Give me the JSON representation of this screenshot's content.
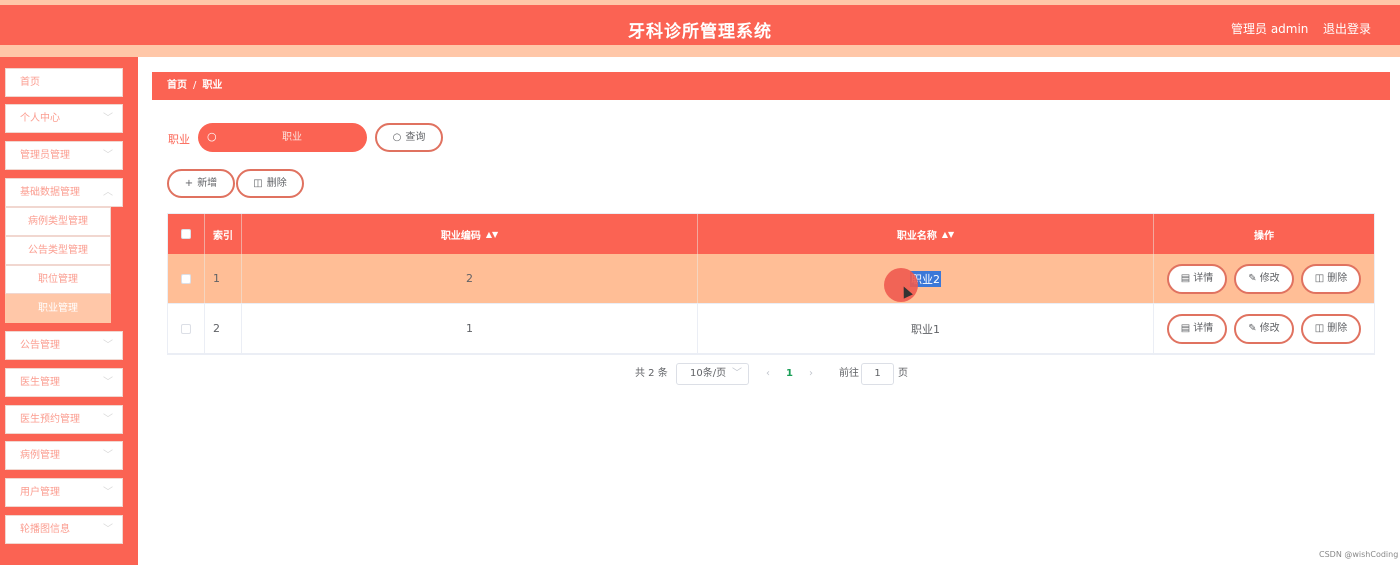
{
  "header": {
    "title": "牙科诊所管理系统",
    "admin_text": "管理员 admin",
    "logout": "退出登录"
  },
  "sidebar": {
    "items": [
      {
        "label": "首页",
        "has_chevron": false
      },
      {
        "label": "个人中心",
        "has_chevron": true
      },
      {
        "label": "管理员管理",
        "has_chevron": true
      },
      {
        "label": "基础数据管理",
        "has_chevron": true,
        "expanded": true
      },
      {
        "label": "公告管理",
        "has_chevron": true
      },
      {
        "label": "医生管理",
        "has_chevron": true
      },
      {
        "label": "医生预约管理",
        "has_chevron": true
      },
      {
        "label": "病例管理",
        "has_chevron": true
      },
      {
        "label": "用户管理",
        "has_chevron": true
      },
      {
        "label": "轮播图信息",
        "has_chevron": true
      }
    ],
    "sub_items": [
      {
        "label": "病例类型管理"
      },
      {
        "label": "公告类型管理"
      },
      {
        "label": "职位管理"
      },
      {
        "label": "职业管理",
        "active": true
      }
    ]
  },
  "breadcrumb": {
    "home": "首页",
    "separator": "/",
    "current": "职业"
  },
  "search": {
    "label": "职业",
    "placeholder": "职业",
    "value": "",
    "search_icon": "search-icon",
    "query_button": "查询"
  },
  "toolbar": {
    "add_button": "新增",
    "delete_button": "删除"
  },
  "table": {
    "columns": [
      "",
      "索引",
      "职业编码",
      "职业名称",
      "操作"
    ],
    "rows": [
      {
        "index": "1",
        "code": "2",
        "name": "职业2"
      },
      {
        "index": "2",
        "code": "1",
        "name": "职业1"
      }
    ],
    "row_actions": {
      "detail": "详情",
      "edit": "修改",
      "delete": "删除"
    }
  },
  "pagination": {
    "total": "共 2 条",
    "page_size": "10条/页",
    "current_page": "1",
    "goto_label": "前往",
    "goto_value": "1",
    "page_suffix": "页"
  },
  "watermark": "CSDN @wishCoding",
  "colors": {
    "primary": "#fb6353",
    "accent": "#ffc7a8",
    "row_highlight": "#ffbe96",
    "selection": "#3c78d8"
  }
}
